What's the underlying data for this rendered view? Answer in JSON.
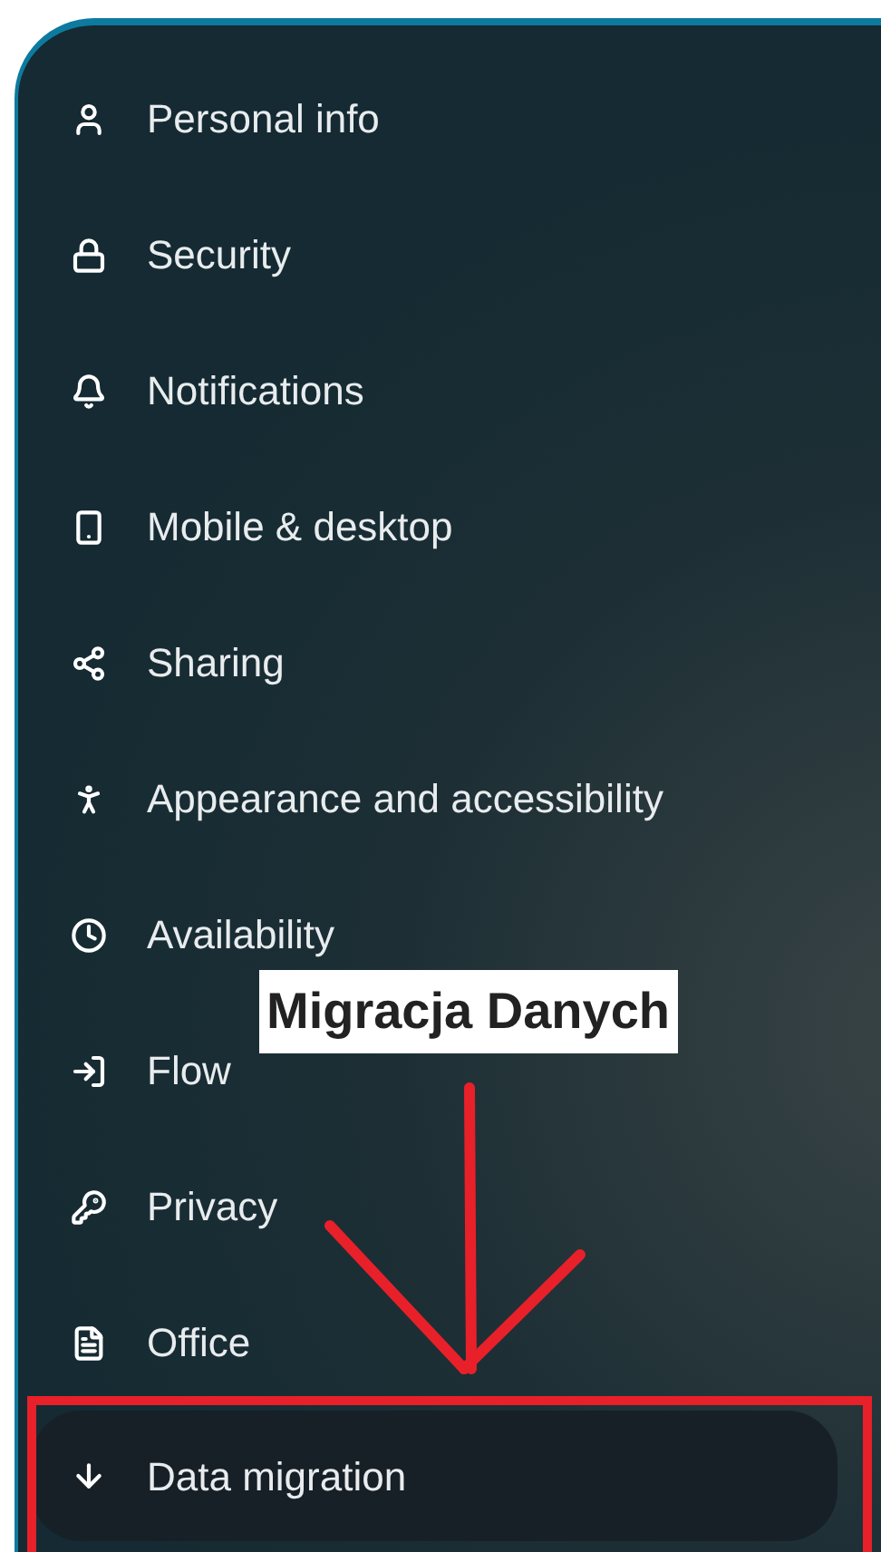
{
  "menu": {
    "items": [
      {
        "label": "Personal info",
        "selected": false
      },
      {
        "label": "Security",
        "selected": false
      },
      {
        "label": "Notifications",
        "selected": false
      },
      {
        "label": "Mobile & desktop",
        "selected": false
      },
      {
        "label": "Sharing",
        "selected": false
      },
      {
        "label": "Appearance and accessibility",
        "selected": false
      },
      {
        "label": "Availability",
        "selected": false
      },
      {
        "label": "Flow",
        "selected": false
      },
      {
        "label": "Privacy",
        "selected": false
      },
      {
        "label": "Office",
        "selected": false
      },
      {
        "label": "Data migration",
        "selected": true
      }
    ]
  },
  "annotation": {
    "label": "Migracja Danych"
  }
}
